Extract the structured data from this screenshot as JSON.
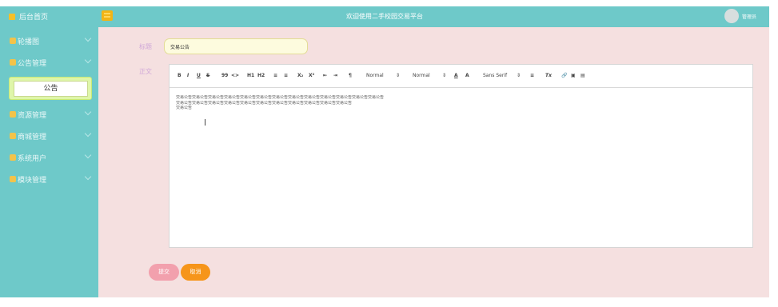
{
  "topbar": {
    "home_label": "后台首页",
    "site_title": "欢迎使用二手校园交易平台",
    "username": "管理员"
  },
  "sidebar": {
    "items": [
      {
        "label": "轮播图",
        "icon": "image-icon"
      },
      {
        "label": "公告管理",
        "icon": "notice-icon"
      },
      {
        "label": "资源管理",
        "icon": "resource-icon"
      },
      {
        "label": "商城管理",
        "icon": "shop-icon"
      },
      {
        "label": "系统用户",
        "icon": "user-icon"
      },
      {
        "label": "模块管理",
        "icon": "module-icon"
      }
    ],
    "active_subitem": "公告"
  },
  "form": {
    "title_label": "标题",
    "title_value": "交易公告",
    "body_label": "正文",
    "submit_label": "提交",
    "cancel_label": "取消"
  },
  "editor": {
    "toolbar": {
      "bold": "B",
      "italic": "I",
      "underline": "U",
      "strike": "S",
      "quote": "99",
      "code": "<>",
      "h1": "H1",
      "h2": "H2",
      "ordered_list": "≡",
      "bullet_list": "≡",
      "subscript": "X₂",
      "superscript": "X²",
      "indent_left": "⇤",
      "indent_right": "⇥",
      "direction": "¶",
      "size_select": "Normal",
      "header_select": "Normal",
      "color": "A",
      "background": "A",
      "font_select": "Sans Serif",
      "align": "≡",
      "clean": "Tx",
      "link": "🔗",
      "image": "▣",
      "video": "▤"
    },
    "lines": [
      "交易公告交易公告交易公告交易公告交易公告交易公告交易公告交易公告交易公告交易公告交易公告交易公告交易公告",
      "交易公告交易公告交易公告交易公告交易公告交易公告交易公告交易公告交易公告交易公告交易公告",
      "交易公告"
    ]
  }
}
